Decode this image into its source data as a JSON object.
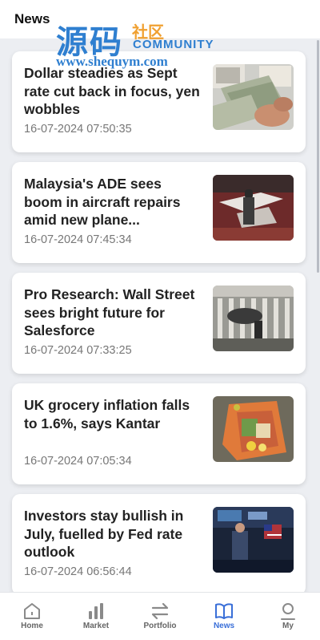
{
  "header": {
    "title": "News"
  },
  "watermark": {
    "cn": "源码",
    "cn_small": "社区",
    "en": "COMMUNITY",
    "url": "www.shequym.com"
  },
  "articles": [
    {
      "title": "Dollar steadies as Sept rate cut back in focus, yen wobbles",
      "time": "16-07-2024 07:50:35"
    },
    {
      "title": "Malaysia's ADE sees boom in aircraft repairs amid new plane...",
      "time": "16-07-2024 07:45:34"
    },
    {
      "title": "Pro Research: Wall Street sees bright future for Salesforce",
      "time": "16-07-2024 07:33:25"
    },
    {
      "title": "UK grocery inflation falls to 1.6%, says Kantar",
      "time": "16-07-2024 07:05:34"
    },
    {
      "title": "Investors stay bullish in July, fuelled by Fed rate outlook",
      "time": "16-07-2024 06:56:44"
    }
  ],
  "tabs": [
    {
      "label": "Home",
      "icon": "home-icon"
    },
    {
      "label": "Market",
      "icon": "bar-chart-icon"
    },
    {
      "label": "Portfolio",
      "icon": "swap-arrows-icon"
    },
    {
      "label": "News",
      "icon": "book-icon"
    },
    {
      "label": "My",
      "icon": "user-icon"
    }
  ],
  "colors": {
    "accent": "#3a6fd8",
    "inactive": "#666666",
    "background": "#eceef2"
  }
}
